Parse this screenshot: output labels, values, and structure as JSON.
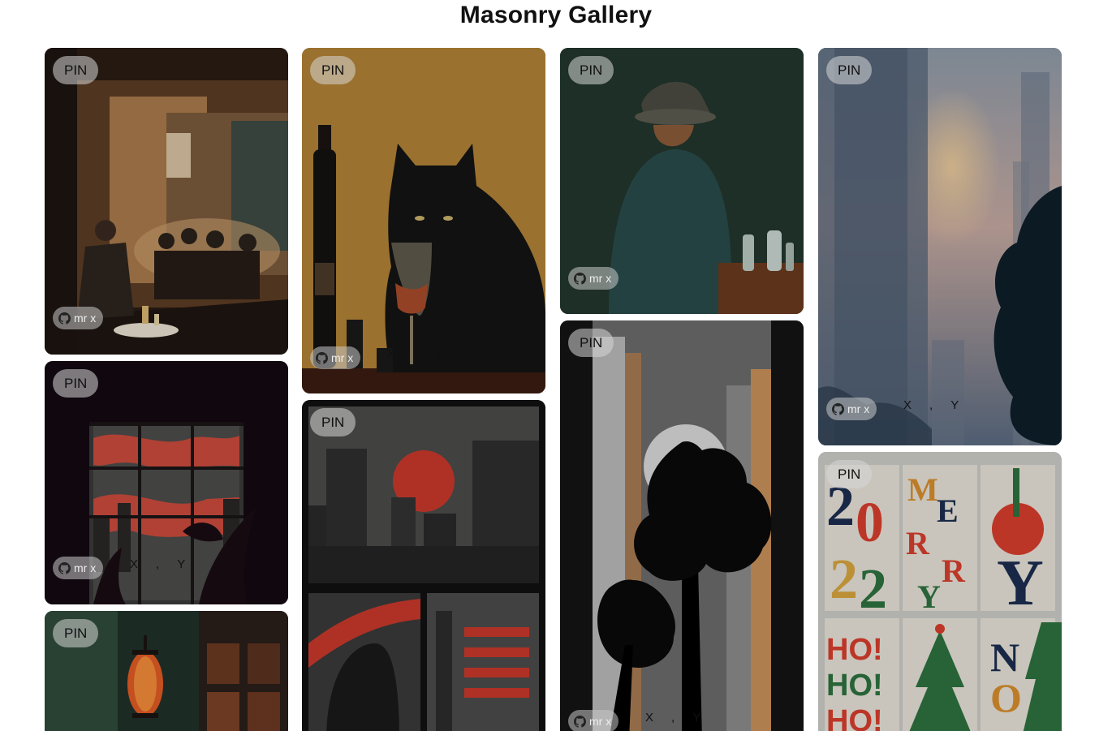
{
  "page": {
    "title": "Masonry Gallery"
  },
  "card": {
    "pin_label": "PIN",
    "author_label": "mr x",
    "author_icon": "github-icon",
    "share_x_label": "X",
    "share_sep": ",",
    "share_y_label": "Y"
  },
  "images": [
    {
      "id": "cafe-men",
      "subject": "Men drinking in a dimly lit bar"
    },
    {
      "id": "cat-wine",
      "subject": "Black cat with wine glass and bottle"
    },
    {
      "id": "man-hat",
      "subject": "Man in a hat seated at a bar counter"
    },
    {
      "id": "foggy-city",
      "subject": "Foggy skyscrapers at sunset with trees"
    },
    {
      "id": "window-red",
      "subject": "Window with red clouds and plants"
    },
    {
      "id": "red-sun-city",
      "subject": "Red sun over city skyline comic panels"
    },
    {
      "id": "city-tree",
      "subject": "Black silhouette tree between buildings"
    },
    {
      "id": "lantern",
      "subject": "Red lantern in rain"
    },
    {
      "id": "xmas-poster",
      "subject": "2022 Merry Christmas typographic posters"
    }
  ]
}
